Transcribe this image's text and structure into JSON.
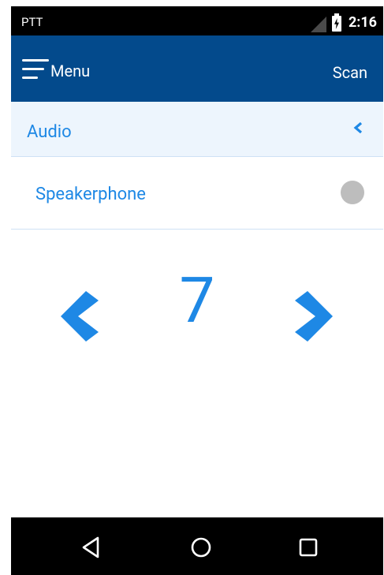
{
  "status_bar": {
    "carrier": "PTT",
    "time": "2:16"
  },
  "app_bar": {
    "menu_label": "Menu",
    "scan_label": "Scan"
  },
  "audio_section": {
    "title": "Audio",
    "collapse_icon": "chevron-left-icon"
  },
  "speakerphone": {
    "label": "Speakerphone",
    "enabled": false
  },
  "stepper": {
    "value": "7",
    "decrement_icon": "chevron-left-icon",
    "increment_icon": "chevron-right-icon"
  },
  "nav_bar": {
    "back_icon": "back-triangle-icon",
    "home_icon": "home-circle-icon",
    "recents_icon": "recents-square-icon"
  },
  "colors": {
    "app_bar": "#034a8c",
    "accent": "#1e88e5",
    "header_bg": "#edf5fd",
    "toggle_off": "#bdbdbd"
  }
}
